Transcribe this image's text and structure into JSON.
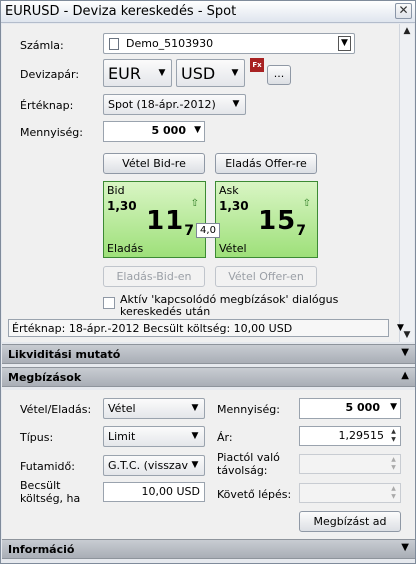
{
  "window": {
    "title": "EURUSD - Deviza kereskedés - Spot"
  },
  "trade": {
    "account_label": "Számla:",
    "account_value": "Demo_5103930",
    "pair_label": "Devizapár:",
    "base_currency": "EUR",
    "quote_currency": "USD",
    "fx_badge": "Fx",
    "more_button": "...",
    "value_date_label": "Értéknap:",
    "value_date_value": "Spot (18-ápr.-2012)",
    "amount_label": "Mennyiség:",
    "amount_value": "5 000",
    "buy_bid_button": "Vétel Bid-re",
    "sell_offer_button": "Eladás Offer-re",
    "bid": {
      "title": "Bid",
      "prefix": "1,30",
      "pips": "11",
      "fraction": "7",
      "side": "Eladás"
    },
    "ask": {
      "title": "Ask",
      "prefix": "1,30",
      "pips": "15",
      "fraction": "7",
      "side": "Vétel"
    },
    "spread": "4,0",
    "sell_bid_button": "Eladás-Bid-en",
    "buy_offer_button": "Vétel Offer-en",
    "related_orders_checkbox": "Aktív 'kapcsolódó megbízások' dialógus kereskedés után",
    "status_text": "Értéknap: 18-ápr.-2012  Becsült költség: 10,00 USD"
  },
  "sections": {
    "liquidity": "Likviditási mutató",
    "orders": "Megbízások",
    "info": "Információ"
  },
  "orders": {
    "side_label": "Vétel/Eladás:",
    "side_value": "Vétel",
    "type_label": "Típus:",
    "type_value": "Limit",
    "duration_label": "Futamidő:",
    "duration_value": "G.T.C. (visszavo",
    "est_cost_label_1": "Becsült",
    "est_cost_label_2": "költség, ha",
    "est_cost_value": "10,00 USD",
    "quantity_label": "Mennyiség:",
    "quantity_value": "5 000",
    "price_label": "Ár:",
    "price_value": "1,29515",
    "distance_label_1": "Piactól való",
    "distance_label_2": "távolság:",
    "trailing_label": "Követő lépés:",
    "place_order_button": "Megbízást ad"
  },
  "colors": {
    "quote_green": "#9ee07a",
    "section_gray": "#a9aeb6"
  }
}
